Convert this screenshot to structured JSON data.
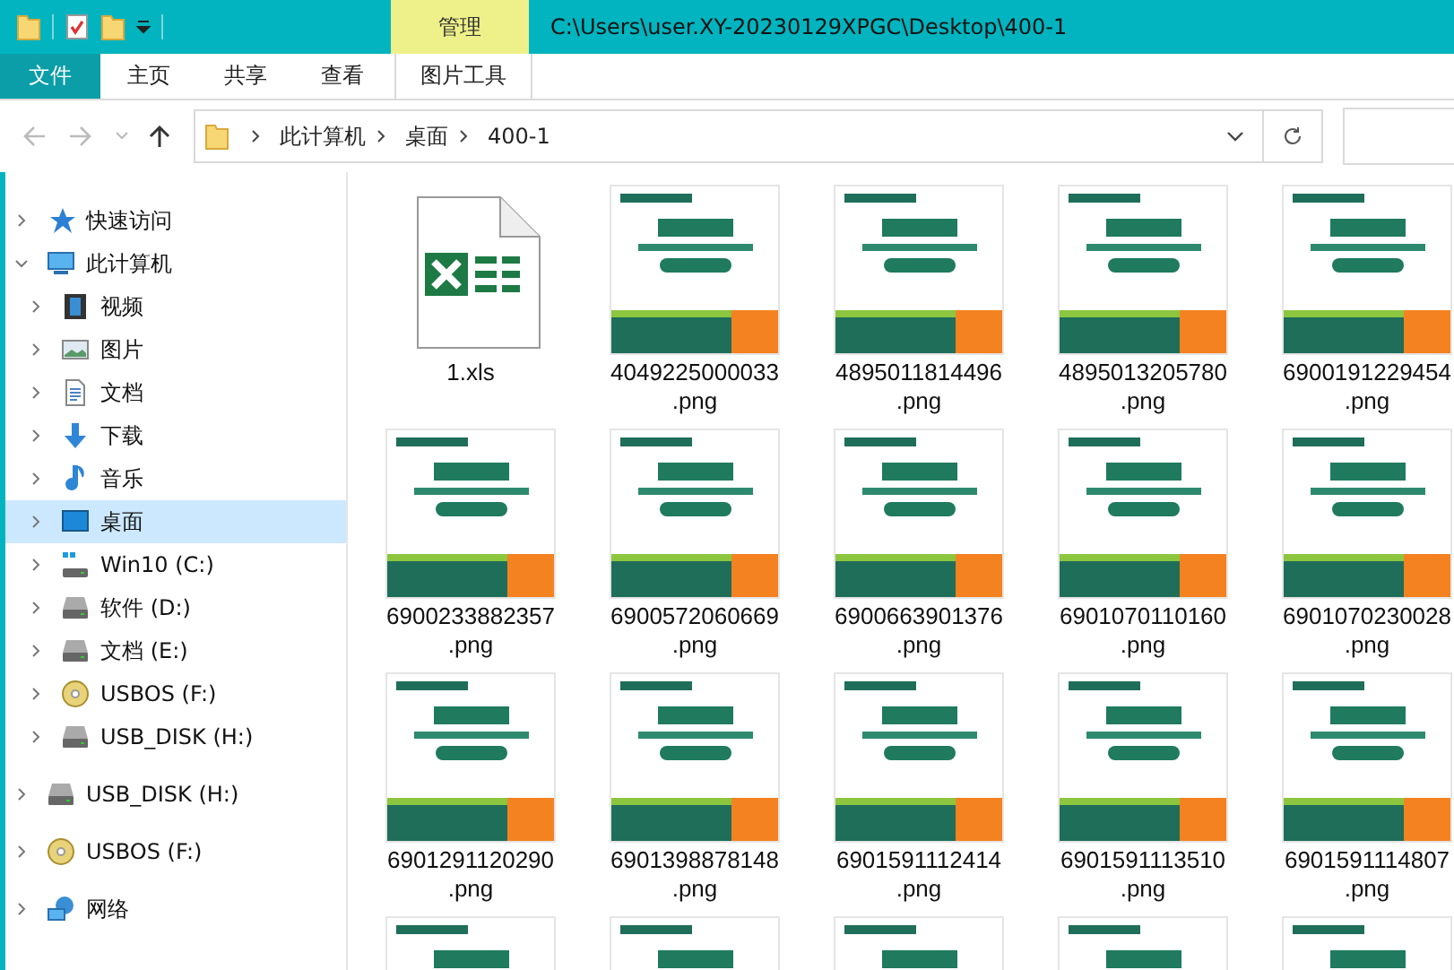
{
  "title_bar": {
    "context_tab": "管理",
    "path": "C:\\Users\\user.XY-20230129XPGC\\Desktop\\400-1"
  },
  "ribbon_tabs": [
    {
      "label": "文件",
      "kind": "file"
    },
    {
      "label": "主页",
      "kind": "tab"
    },
    {
      "label": "共享",
      "kind": "tab"
    },
    {
      "label": "查看",
      "kind": "tab"
    },
    {
      "label": "图片工具",
      "kind": "context"
    }
  ],
  "address_bar": {
    "crumbs": [
      "此计算机",
      "桌面",
      "400-1"
    ]
  },
  "sidebar": {
    "items": [
      {
        "label": "快速访问",
        "kind": "star",
        "expanded": false,
        "selected": false
      },
      {
        "label": "此计算机",
        "kind": "pc",
        "expanded": true,
        "selected": false,
        "children": [
          {
            "label": "视频",
            "kind": "video",
            "expanded": false,
            "selected": false
          },
          {
            "label": "图片",
            "kind": "picture",
            "expanded": false,
            "selected": false
          },
          {
            "label": "文档",
            "kind": "doc",
            "expanded": false,
            "selected": false
          },
          {
            "label": "下载",
            "kind": "download",
            "expanded": false,
            "selected": false
          },
          {
            "label": "音乐",
            "kind": "music",
            "expanded": false,
            "selected": false
          },
          {
            "label": "桌面",
            "kind": "desktop",
            "expanded": false,
            "selected": true
          },
          {
            "label": "Win10 (C:)",
            "kind": "windrive",
            "expanded": false,
            "selected": false
          },
          {
            "label": "软件 (D:)",
            "kind": "drive",
            "expanded": false,
            "selected": false
          },
          {
            "label": "文档 (E:)",
            "kind": "drive",
            "expanded": false,
            "selected": false
          },
          {
            "label": "USBOS (F:)",
            "kind": "disc",
            "expanded": false,
            "selected": false
          },
          {
            "label": "USB_DISK (H:)",
            "kind": "drive",
            "expanded": false,
            "selected": false
          }
        ]
      },
      {
        "label": "USB_DISK (H:)",
        "kind": "drive",
        "expanded": false,
        "selected": false
      },
      {
        "label": "USBOS (F:)",
        "kind": "disc",
        "expanded": false,
        "selected": false
      },
      {
        "label": "网络",
        "kind": "network",
        "expanded": false,
        "selected": false
      }
    ]
  },
  "files": [
    {
      "kind": "xls",
      "name": "1.xls"
    },
    {
      "kind": "png",
      "name": "4049225000033",
      "ext": ".png"
    },
    {
      "kind": "png",
      "name": "4895011814496",
      "ext": ".png"
    },
    {
      "kind": "png",
      "name": "4895013205780",
      "ext": ".png"
    },
    {
      "kind": "png",
      "name": "6900191229454",
      "ext": ".png"
    },
    {
      "kind": "png",
      "name": "6900233882357",
      "ext": ".png"
    },
    {
      "kind": "png",
      "name": "6900572060669",
      "ext": ".png"
    },
    {
      "kind": "png",
      "name": "6900663901376",
      "ext": ".png"
    },
    {
      "kind": "png",
      "name": "6901070110160",
      "ext": ".png"
    },
    {
      "kind": "png",
      "name": "6901070230028",
      "ext": ".png"
    },
    {
      "kind": "png",
      "name": "6901291120290",
      "ext": ".png"
    },
    {
      "kind": "png",
      "name": "6901398878148",
      "ext": ".png"
    },
    {
      "kind": "png",
      "name": "6901591112414",
      "ext": ".png"
    },
    {
      "kind": "png",
      "name": "6901591113510",
      "ext": ".png"
    },
    {
      "kind": "png",
      "name": "6901591114807",
      "ext": ".png"
    },
    {
      "kind": "png"
    },
    {
      "kind": "png"
    },
    {
      "kind": "png"
    },
    {
      "kind": "png"
    },
    {
      "kind": "png"
    }
  ]
}
